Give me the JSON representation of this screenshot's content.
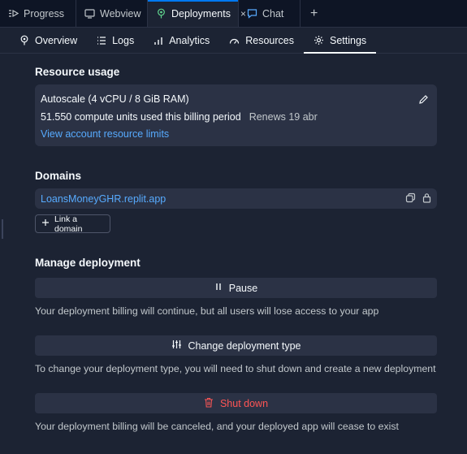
{
  "tabs": [
    {
      "label": "Progress",
      "icon": "progress-icon"
    },
    {
      "label": "Webview",
      "icon": "webview-icon"
    },
    {
      "label": "Deployments",
      "icon": "deployments-icon",
      "active": true,
      "close": "×"
    },
    {
      "label": "Chat",
      "icon": "chat-icon"
    }
  ],
  "add_tab": "+",
  "subnav": [
    {
      "label": "Overview",
      "icon": "overview-icon"
    },
    {
      "label": "Logs",
      "icon": "logs-icon"
    },
    {
      "label": "Analytics",
      "icon": "analytics-icon"
    },
    {
      "label": "Resources",
      "icon": "resources-icon"
    },
    {
      "label": "Settings",
      "icon": "gear-icon",
      "active": true
    }
  ],
  "resource_usage": {
    "title": "Resource usage",
    "plan": "Autoscale (4 vCPU / 8 GiB RAM)",
    "usage": "51.550 compute units used this billing period",
    "renews": "Renews 19 abr",
    "link": "View account resource limits"
  },
  "domains": {
    "title": "Domains",
    "domain": "LoansMoneyGHR.replit.app",
    "link_button": "Link a domain"
  },
  "manage": {
    "title": "Manage deployment",
    "pause_label": "Pause",
    "pause_desc": "Your deployment billing will continue, but all users will lose access to your app",
    "change_label": "Change deployment type",
    "change_desc": "To change your deployment type, you will need to shut down and create a new deployment",
    "shutdown_label": "Shut down",
    "shutdown_desc": "Your deployment billing will be canceled, and your deployed app will cease to exist"
  },
  "colors": {
    "background": "#1c2333",
    "card": "#2b3245",
    "link": "#57abff",
    "danger": "#f55555",
    "active_tab_accent": "#0079f2"
  }
}
